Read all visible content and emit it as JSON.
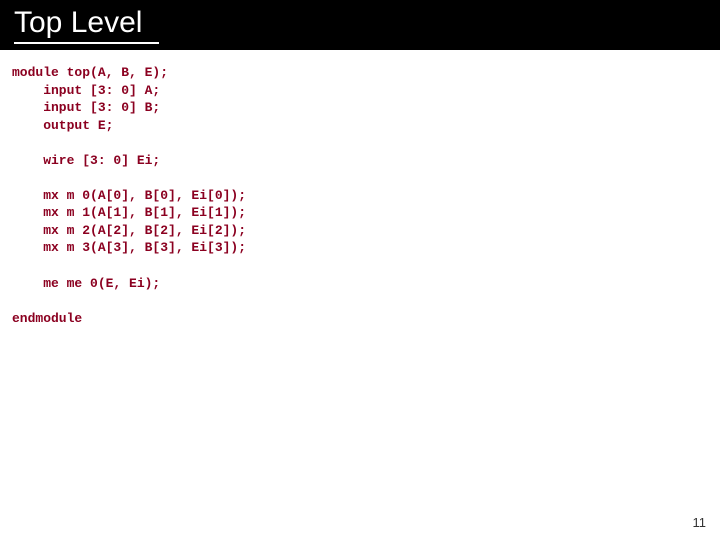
{
  "title": "Top Level",
  "code": {
    "l01": "module top(A, B, E);",
    "l02": "    input [3: 0] A;",
    "l03": "    input [3: 0] B;",
    "l04": "    output E;",
    "l05": "",
    "l06": "    wire [3: 0] Ei;",
    "l07": "",
    "l08": "    mx m 0(A[0], B[0], Ei[0]);",
    "l09": "    mx m 1(A[1], B[1], Ei[1]);",
    "l10": "    mx m 2(A[2], B[2], Ei[2]);",
    "l11": "    mx m 3(A[3], B[3], Ei[3]);",
    "l12": "",
    "l13": "    me me 0(E, Ei);",
    "l14": "",
    "l15": "endmodule"
  },
  "page_number": "11"
}
